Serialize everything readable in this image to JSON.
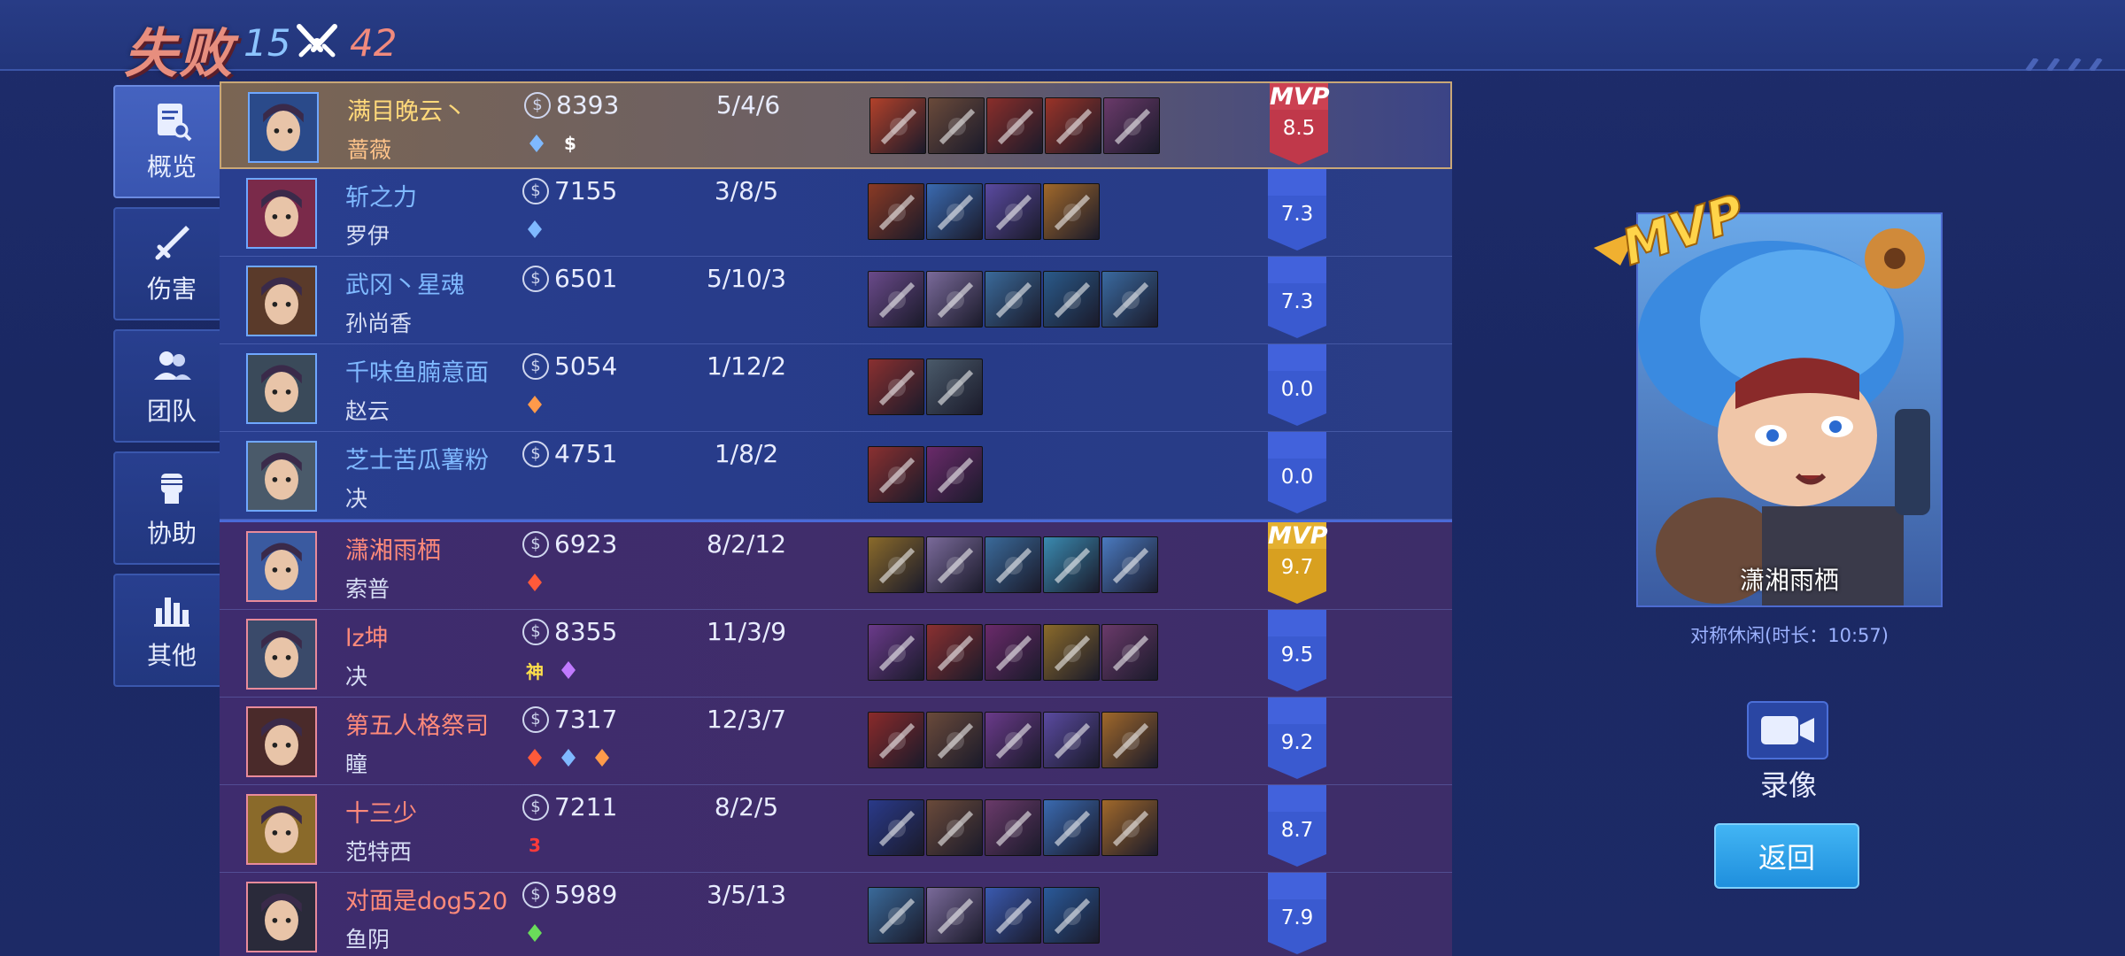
{
  "header": {
    "result": "失败",
    "blue_kills": "15",
    "red_kills": "42"
  },
  "sidebar": {
    "items": [
      {
        "label": "概览",
        "icon": "document-search-icon",
        "active": true
      },
      {
        "label": "伤害",
        "icon": "sword-icon",
        "active": false
      },
      {
        "label": "团队",
        "icon": "team-icon",
        "active": false
      },
      {
        "label": "协助",
        "icon": "fist-icon",
        "active": false
      },
      {
        "label": "其他",
        "icon": "bar-chart-icon",
        "active": false
      }
    ]
  },
  "players": [
    {
      "team": "blue",
      "name": "满目晚云丶",
      "hero": "蔷薇",
      "gold": "8393",
      "kda": "5/4/6",
      "score": "8.5",
      "mvp": "MVP",
      "badges": [
        {
          "icon": "flame-outline-icon",
          "text": "",
          "color": "#7fb9ff"
        },
        {
          "icon": "coin-badge-icon",
          "text": "$",
          "color": "#ffffff"
        }
      ],
      "items": [
        "#b2412a",
        "#6a4a3a",
        "#8a2e2a",
        "#9a3327",
        "#6a3a6a"
      ]
    },
    {
      "team": "blue",
      "name": "斩之力",
      "hero": "罗伊",
      "gold": "7155",
      "kda": "3/8/5",
      "score": "7.3",
      "badges": [
        {
          "icon": "shield-icon",
          "text": "",
          "color": "#7fb9ff"
        }
      ],
      "items": [
        "#8a3a24",
        "#3a6ab0",
        "#5a4aa0",
        "#a0682a"
      ]
    },
    {
      "team": "blue",
      "name": "武冈丶星魂",
      "hero": "孙尚香",
      "gold": "6501",
      "kda": "5/10/3",
      "score": "7.3",
      "badges": [],
      "items": [
        "#6a4a8a",
        "#7a6a9a",
        "#3a6a9a",
        "#2a5a8a",
        "#3a6aa0"
      ]
    },
    {
      "team": "blue",
      "name": "千味鱼腩意面",
      "hero": "赵云",
      "gold": "5054",
      "kda": "1/12/2",
      "score": "0.0",
      "badges": [
        {
          "icon": "feather-icon",
          "text": "",
          "color": "#ff9a4a"
        }
      ],
      "items": [
        "#8a3030",
        "#4a5a6a"
      ]
    },
    {
      "team": "blue",
      "name": "芝士苦瓜薯粉",
      "hero": "决",
      "gold": "4751",
      "kda": "1/8/2",
      "score": "0.0",
      "badges": [],
      "items": [
        "#8a3030",
        "#6a2a6a"
      ]
    },
    {
      "team": "red",
      "name": "潇湘雨栖",
      "hero": "索普",
      "gold": "6923",
      "kda": "8/2/12",
      "score": "9.7",
      "mvp": "MVP",
      "badges": [
        {
          "icon": "fire-icon",
          "text": "",
          "color": "#ff5a3a"
        }
      ],
      "items": [
        "#8a6a2a",
        "#7a6a9a",
        "#3a6a9a",
        "#3a8ab0",
        "#4a7ac0"
      ]
    },
    {
      "team": "red",
      "name": "lz坤",
      "hero": "决",
      "gold": "8355",
      "kda": "11/3/9",
      "score": "9.5",
      "badges": [
        {
          "icon": "god-icon",
          "text": "神",
          "color": "#ffe04a"
        },
        {
          "icon": "tower-icon",
          "text": "",
          "color": "#c07aff"
        }
      ],
      "items": [
        "#6a3a8a",
        "#8a3030",
        "#6a2a6a",
        "#8a6a2a",
        "#6a3a6a"
      ]
    },
    {
      "team": "red",
      "name": "第五人格祭司",
      "hero": "瞳",
      "gold": "7317",
      "kda": "12/3/7",
      "score": "9.2",
      "badges": [
        {
          "icon": "arrow-icon",
          "text": "",
          "color": "#ff5a3a"
        },
        {
          "icon": "eye-icon",
          "text": "",
          "color": "#7fb9ff"
        },
        {
          "icon": "feather-icon",
          "text": "",
          "color": "#ff9a4a"
        }
      ],
      "items": [
        "#8a2a2a",
        "#6a4a3a",
        "#6a3a8a",
        "#5a4aa0",
        "#a0682a"
      ]
    },
    {
      "team": "red",
      "name": "十三少",
      "hero": "范特西",
      "gold": "7211",
      "kda": "8/2/5",
      "score": "8.7",
      "badges": [
        {
          "icon": "triple-kill-icon",
          "text": "3",
          "color": "#ff3a3a"
        }
      ],
      "items": [
        "#2a3a8a",
        "#6a4a3a",
        "#6a3a6a",
        "#3a6ab0",
        "#a0682a"
      ]
    },
    {
      "team": "red",
      "name": "对面是dog520",
      "hero": "鱼阴",
      "gold": "5989",
      "kda": "3/5/13",
      "score": "7.9",
      "badges": [
        {
          "icon": "fist-icon",
          "text": "",
          "color": "#6adc5a"
        }
      ],
      "items": [
        "#3a6a9a",
        "#7a6a9a",
        "#3a5ab0",
        "#2a5a9a"
      ]
    }
  ],
  "mvp_panel": {
    "name": "潇湘雨栖",
    "mode": "对称休闲(时长：10:57)",
    "record_label": "录像",
    "back_label": "返回"
  }
}
